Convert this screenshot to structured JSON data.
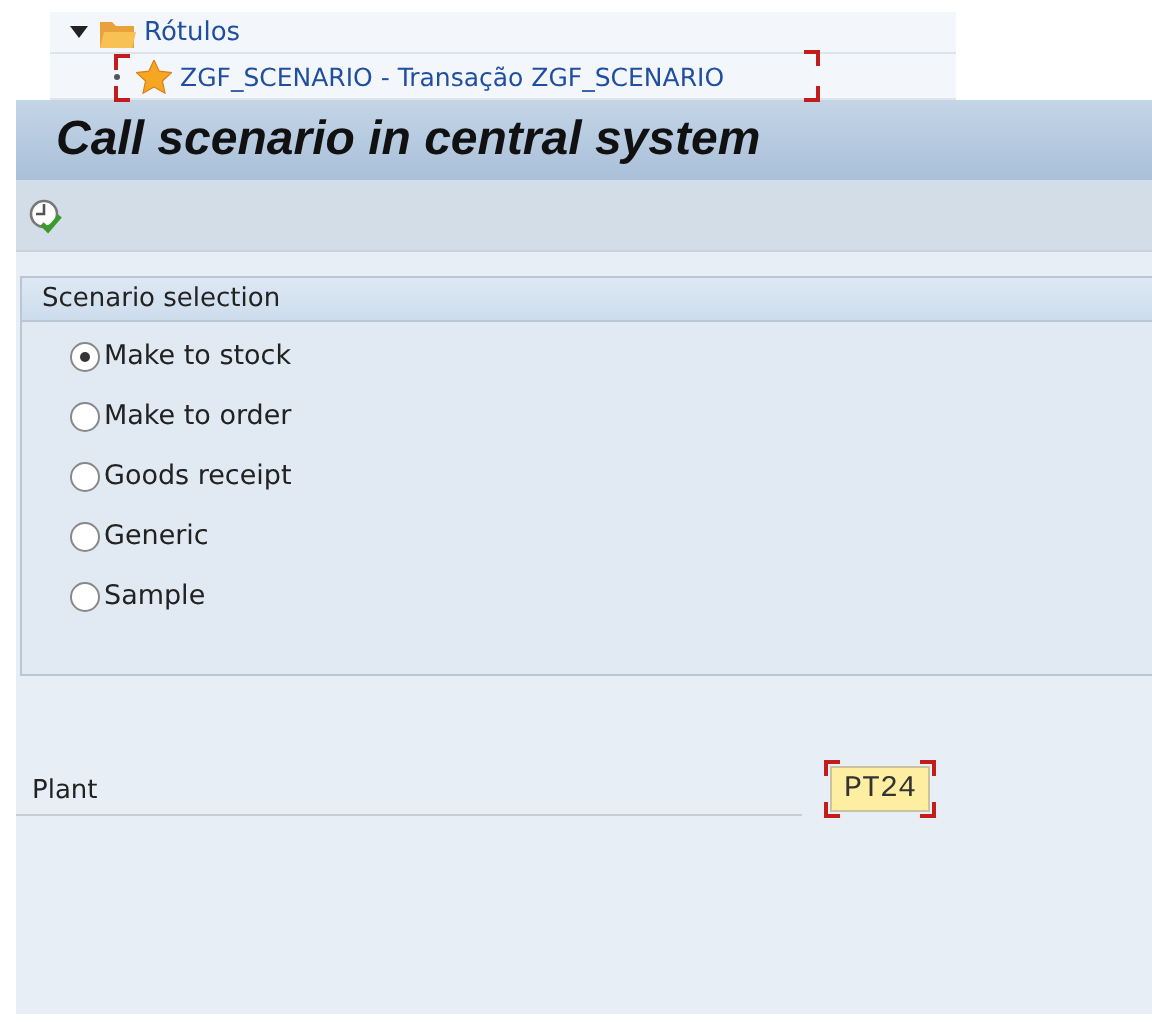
{
  "tree": {
    "label": "Rótulos",
    "expanded": true,
    "children": [
      {
        "label": "ZGF_SCENARIO - Transação ZGF_SCENARIO",
        "focused": true
      }
    ]
  },
  "title": "Call scenario in central system",
  "group": {
    "title": "Scenario selection",
    "options": [
      {
        "label": "Make to stock",
        "selected": true
      },
      {
        "label": "Make to order",
        "selected": false
      },
      {
        "label": "Goods receipt",
        "selected": false
      },
      {
        "label": "Generic",
        "selected": false
      },
      {
        "label": "Sample",
        "selected": false
      }
    ]
  },
  "plant": {
    "label": "Plant",
    "value": "PT24",
    "focused": true
  }
}
